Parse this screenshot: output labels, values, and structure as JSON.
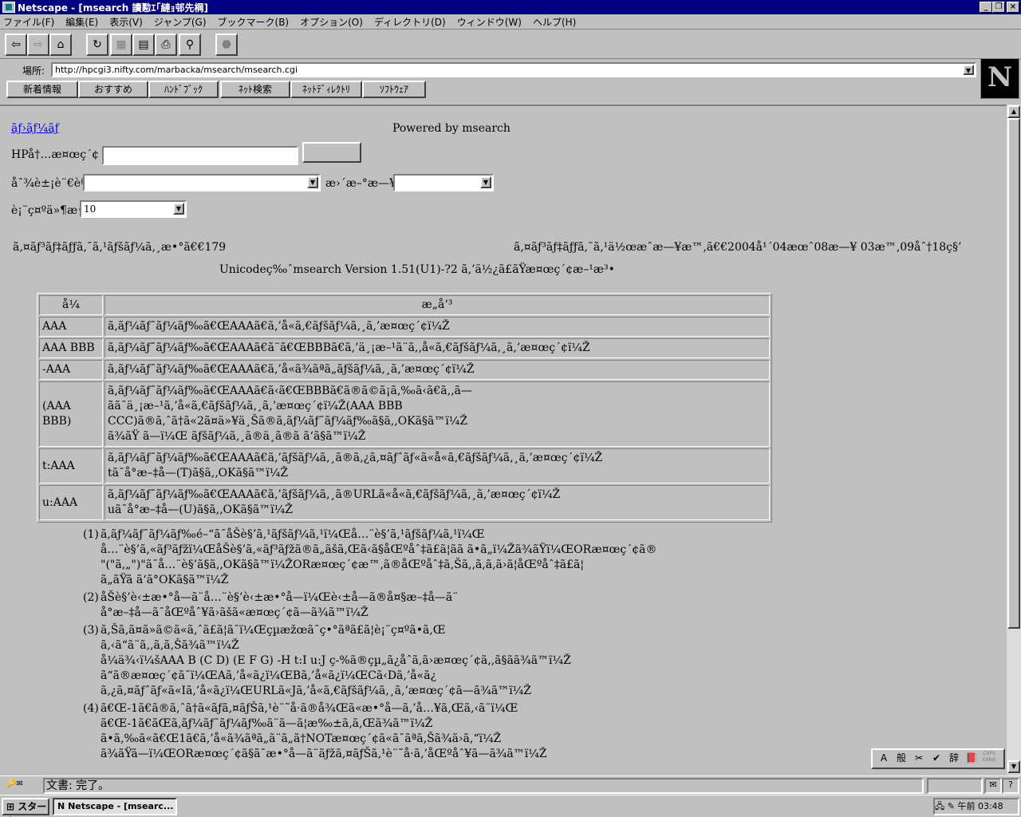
{
  "window": {
    "title": "Netscape - [msearch 讀懃ｴ｢縺ｮ邨先棡]",
    "controls": [
      "_",
      "❐",
      "×"
    ]
  },
  "menu": [
    "ファイル(F)",
    "編集(E)",
    "表示(V)",
    "ジャンプ(G)",
    "ブックマーク(B)",
    "オプション(O)",
    "ディレクトリ(D)",
    "ウィンドウ(W)",
    "ヘルプ(H)"
  ],
  "toolbar": {
    "icons": [
      "back-icon",
      "forward-icon",
      "home-icon",
      "reload-icon",
      "images-icon",
      "open-icon",
      "print-icon",
      "find-icon",
      "stop-icon"
    ]
  },
  "location": {
    "label": "場所:",
    "url": "http://hpcgi3.nifty.com/marbacka/msearch/msearch.cgi"
  },
  "personal_toolbar": [
    "新着情報",
    "おすすめ",
    "ﾊﾝﾄﾞﾌﾞｯｸ",
    "ﾈｯﾄ検索",
    "ﾈｯﾄﾃﾞｨﾚｸﾄﾘ",
    "ｿﾌﾄｳｪｱ"
  ],
  "page": {
    "top_link": "ãƒ›ãƒ¼ãƒ ",
    "powered_by": "Powered by msearch",
    "search_label": "HPå†…æ¤œç´¢",
    "search_value": "",
    "search_button": "",
    "method_label": "å¯¾è±¡è¨€èªž",
    "method_value": "",
    "date_label": "æ›´æ–°æ—¥",
    "date_value": "",
    "count_label": "è¡¨ç¤ºä»¶æ•°",
    "count_value": "10",
    "index_info": "ã‚¤ãƒ³ãƒ‡ãƒƒã‚¯ã‚¹ãƒšãƒ¼ã‚¸æ•°ã€€179",
    "index_date": "ã‚¤ãƒ³ãƒ‡ãƒƒã‚¯ã‚¹ä½œæˆæ—¥æ™‚ã€€2004å¹´04æœˆ08æ—¥ 03æ™‚09åˆ†18ç§’",
    "version": "Unicodeç‰ˆmsearch  Version 1.51(U1)-?2 ã‚’ä½¿ã£ãŸæ¤œç´¢æ–¹æ³•",
    "table": {
      "headers": [
        "å¼",
        "æ„å‘³"
      ],
      "rows": [
        {
          "key": "AAA",
          "lines": [
            "ã‚­ãƒ¼ãƒ¯ãƒ¼ãƒ‰ã€ŒAAAã€ã‚’å«ã‚€ãƒšãƒ¼ã‚¸ã‚’æ¤œç´¢ï¼Ž"
          ]
        },
        {
          "key": "AAA BBB",
          "lines": [
            "ã‚­ãƒ¼ãƒ¯ãƒ¼ãƒ‰ã€ŒAAAã€ã¨ã€ŒBBBã€ã‚’ä¸¡æ–¹ã¨ã‚‚å«ã‚€ãƒšãƒ¼ã‚¸ã‚’æ¤œç´¢ï¼Ž"
          ]
        },
        {
          "key": "-AAA",
          "lines": [
            "ã‚­ãƒ¼ãƒ¯ãƒ¼ãƒ‰ã€ŒAAAã€ã‚’å«ã¾ãªã„ãƒšãƒ¼ã‚¸ã‚’æ¤œç´¢ï¼Ž"
          ]
        },
        {
          "key": "(AAA BBB)",
          "lines": [
            "ã‚­ãƒ¼ãƒ¯ãƒ¼ãƒ‰ã€ŒAAAã€ã‹ã€ŒBBBã€ã®ã©ã¡ã‚‰ã‹ã€ã‚‚ã—",
            "ãã¯ä¸¡æ–¹ã‚’å«ã‚€ãƒšãƒ¼ã‚¸ã‚’æ¤œç´¢ï¼Ž(AAA BBB",
            "CCC)ã®ã‚ˆã†ã«2ã¤ä»¥ä¸Šã®ã‚­ãƒ¼ãƒ¯ãƒ¼ãƒ‰ã§ã‚‚OKã§ã™ï¼Ž",
            "ã¾ãŸ ã—ï¼Œ ãƒšãƒ¼ã‚¸ã®ä¸­ã®ã ã‘ã§ã™ï¼Ž"
          ]
        },
        {
          "key": "t:AAA",
          "lines": [
            "ã‚­ãƒ¼ãƒ¯ãƒ¼ãƒ‰ã€ŒAAAã€ã‚’ãƒšãƒ¼ã‚¸ã®ã‚¿ã‚¤ãƒˆãƒ«ã«å«ã‚€ãƒšãƒ¼ã‚¸ã‚’æ¤œç´¢ï¼Ž",
            "tã¯å°æ–‡å­—(T)ã§ã‚‚OKã§ã™ï¼Ž"
          ]
        },
        {
          "key": "u:AAA",
          "lines": [
            "ã‚­ãƒ¼ãƒ¯ãƒ¼ãƒ‰ã€ŒAAAã€ã‚’ãƒšãƒ¼ã‚¸ã®URLã«å«ã‚€ãƒšãƒ¼ã‚¸ã‚’æ¤œç´¢ï¼Ž",
            "uã¯å°æ–‡å­—(U)ã§ã‚‚OKã§ã™ï¼Ž"
          ]
        }
      ]
    },
    "notes": [
      {
        "num": "(1)",
        "lines": [
          "ã‚­ãƒ¼ãƒ¯ãƒ¼ãƒ‰é–“ã¯åŠè§’ã‚¹ãƒšãƒ¼ã‚¹ï¼Œå…¨è§’ã‚¹ãƒšãƒ¼ã‚¹ï¼Œ",
          "å…¨è§’ã‚«ãƒ³ãƒžï¼ŒåŠè§’ã‚«ãƒ³ãƒžã®ã„ãšã‚Œã‹ã§åŒºåˆ‡ã£ã¦ãã ã•ã„ï¼Žã¾ãŸï¼ŒORæ¤œç´¢ã®",
          "\"(\"ã‚„\")\"ã¯å…¨è§’ã§ã‚‚OKã§ã™ï¼ŽORæ¤œç´¢æ™‚ã®åŒºåˆ‡ã‚Šã‚‚ã‚ã‚ã›ã¦åŒºåˆ‡ã£ã¦",
          "ã„ãŸã ã‘ã°OKã§ã™ï¼Ž"
        ]
      },
      {
        "num": "(2)",
        "lines": [
          "åŠè§’è‹±æ•°å­—ã¨å…¨è§’è‹±æ•°å­—ï¼Œè‹±å­—ã®å¤§æ–‡å­—ã¨",
          "å°æ–‡å­—ã¯åŒºåˆ¥ã›ãšã«æ¤œç´¢ã—ã¾ã™ï¼Ž"
        ]
      },
      {
        "num": "(3)",
        "lines": [
          "ã‚Šã‚ã¤ã»ã©ã«ã‚ˆã£ã¦ã¯ï¼Œçµæžœã¯ç•°ãªã£ã¦è¡¨ç¤ºã•ã‚Œ",
          "ã‚‹ã“ã¨ã‚‚ã‚ã‚Šã¾ã™ï¼Ž",
          "å¼ä¾‹ï¼šAAA B (C D) (E F G) -H t:I u:J ç-%ã®çµ„ã¿åˆã‚ã›æ¤œç´¢ã‚‚ã§ãã¾ã™ï¼Ž",
          "ã“ã®æ¤œç´¢ã¯ï¼ŒAã‚’å«ã¿ï¼ŒBã‚’å«ã¿ï¼ŒCã‹Dã‚’å«ã¿",
          "ã‚¿ã‚¤ãƒˆãƒ«ã«Iã‚’å«ã¿ï¼ŒURLã«Jã‚’å«ã‚€ãƒšãƒ¼ã‚¸ã‚’æ¤œç´¢ã—ã¾ã™ï¼Ž"
        ]
      },
      {
        "num": "(4)",
        "lines": [
          "ã€Œ-1ã€ã®ã‚ˆã†ã«ãƒã‚¤ãƒŠã‚¹è¨˜å·ã®å¾Œã«æ•°å­—ã‚’å…¥ã‚Œã‚‹ã¨ï¼Œ",
          "ã€Œ-1ã€ãŒã‚­ãƒ¼ãƒ¯ãƒ¼ãƒ‰ã¨ã—ã¦æ‰±ã‚ã‚Œã¾ã™ï¼Ž",
          "ã•ã‚‰ã«ã€Œ1ã€ã‚’å«ã¾ãªã„ã¨ã„ã†NOTæ¤œç´¢ã«ã¯ãªã‚Šã¾ã›ã‚“ï¼Ž",
          "ã¾ãŸã—ï¼ŒORæ¤œç´¢ã§ã¯æ•°å­—ã¨ãƒžã‚¤ãƒŠã‚¹è¨˜å·ã‚’åŒºåˆ¥ã—ã¾ã™ï¼Ž"
        ]
      }
    ]
  },
  "statusbar": {
    "text": "文書: 完了。"
  },
  "ime": [
    "A",
    "般",
    "✂",
    "✔",
    "辞",
    "📕",
    "CAPS KANA"
  ],
  "taskbar": {
    "start": "スタート",
    "task": "Netscape - [msearc...",
    "clock": "午前 03:48"
  }
}
